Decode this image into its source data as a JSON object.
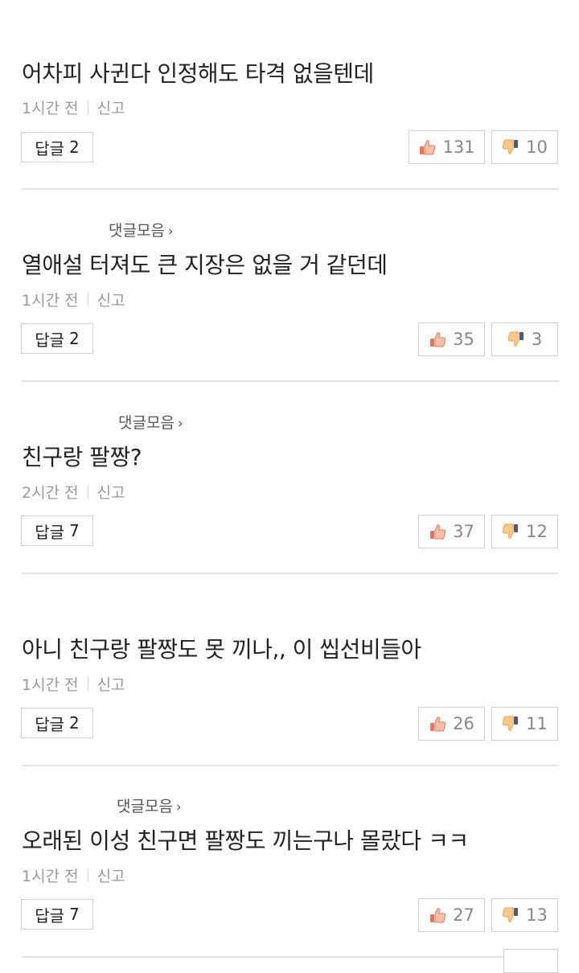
{
  "labels": {
    "report": "신고",
    "reply_prefix": "답글",
    "collection_link": "댓글모음",
    "collection_chevron": "›"
  },
  "comments": [
    {
      "text": "어차피 사귄다 인정해도 타격 없을텐데",
      "time": "1시간 전",
      "replies": "2",
      "likes": "131",
      "dislikes": "10",
      "has_collection_link": false
    },
    {
      "text": "열애설 터져도 큰 지장은 없을 거 같던데",
      "time": "1시간 전",
      "replies": "2",
      "likes": "35",
      "dislikes": "3",
      "has_collection_link": true
    },
    {
      "text": "친구랑 팔짱?",
      "time": "2시간 전",
      "replies": "7",
      "likes": "37",
      "dislikes": "12",
      "has_collection_link": true
    },
    {
      "text": "아니 친구랑 팔짱도 못 끼나,, 이 씹선비들아",
      "time": "1시간 전",
      "replies": "2",
      "likes": "26",
      "dislikes": "11",
      "has_collection_link": false
    },
    {
      "text": "오래된 이성 친구면 팔짱도 끼는구나 몰랐다 ㅋㅋ",
      "time": "1시간 전",
      "replies": "7",
      "likes": "27",
      "dislikes": "13",
      "has_collection_link": true
    }
  ],
  "icons": {
    "like": "thumbs-up-icon",
    "dislike": "thumbs-down-icon"
  },
  "colors": {
    "like_icon": "#e8735a",
    "dislike_icon": "#f0a050",
    "dislike_cuff": "#4a5a7a"
  }
}
